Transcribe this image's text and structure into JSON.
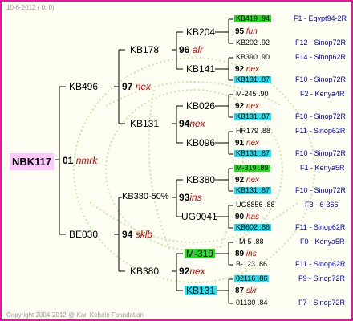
{
  "header": "10-6-2012 ( 0: 0)",
  "footer": "Copyright 2004-2012 @ Karl Kehele Foundation",
  "root": {
    "ring": "NBK117",
    "score": "01",
    "adj": "nmrk"
  },
  "gen1": [
    {
      "ring": "KB496",
      "score": "97",
      "adj": "nex"
    },
    {
      "ring": "BE030",
      "score": "94",
      "adj": "sklb"
    }
  ],
  "gen2": [
    {
      "ring": "KB178",
      "score": "96",
      "adj": "alr"
    },
    {
      "ring": "KB131",
      "score": "94",
      "adj": "nex"
    },
    {
      "ring": "KB380-50%",
      "score": "93",
      "adj": "ins"
    },
    {
      "ring": "KB380",
      "score": "92",
      "adj": "nex"
    }
  ],
  "gen3": [
    {
      "ring": "KB204",
      "score": "95",
      "adj": "fun"
    },
    {
      "ring": "KB141",
      "score": "92",
      "adj": "nex"
    },
    {
      "ring": "KB026",
      "score": "92",
      "adj": "nex"
    },
    {
      "ring": "KB096",
      "score": "91",
      "adj": "nex"
    },
    {
      "ring": "KB380",
      "score": "92",
      "adj": "nex"
    },
    {
      "ring": "UG9041",
      "score": "90",
      "adj": "has"
    },
    {
      "ring": "M-319",
      "score": "89",
      "adj": "ins"
    },
    {
      "ring": "KB131",
      "score": "87",
      "adj": "sl/r"
    }
  ],
  "gen4": [
    {
      "ring": "KB419",
      "val": ".94",
      "ref": "F1 - Egypt94-2R"
    },
    {
      "ring": "KB202",
      "val": ".92",
      "ref": "F12 - Sinop72R"
    },
    {
      "ring": "KB390",
      "val": ".90",
      "ref": "F14 - Sinop62R"
    },
    {
      "ring": "KB131",
      "val": ".87",
      "ref": "F10 - Sinop72R"
    },
    {
      "ring": "M-245",
      "val": ".90",
      "ref": "F2 - Kenya4R"
    },
    {
      "ring": "KB131",
      "val": ".87",
      "ref": "F10 - Sinop72R"
    },
    {
      "ring": "HR179",
      "val": ".88",
      "ref": "F11 - Sinop62R"
    },
    {
      "ring": "KB131",
      "val": ".87",
      "ref": "F10 - Sinop72R"
    },
    {
      "ring": "M-319",
      "val": ".89",
      "ref": "F1 - Kenya5R"
    },
    {
      "ring": "KB131",
      "val": ".87",
      "ref": "F10 - Sinop72R"
    },
    {
      "ring": "UG8856",
      "val": ".88",
      "ref": "F3 - 6-366"
    },
    {
      "ring": "KB602",
      "val": ".86",
      "ref": "F11 - Sinop62R"
    },
    {
      "ring": "M-5",
      "val": ".88",
      "ref": "F0 - Kenya5R"
    },
    {
      "ring": "B-123",
      "val": ".86",
      "ref": "F11 - Sinop62R"
    },
    {
      "ring": "02116",
      "val": ".86",
      "ref": "F9 - Sinop72R"
    },
    {
      "ring": "01130",
      "val": ".84",
      "ref": "F7 - Sinop72R"
    }
  ],
  "colors": {
    "border": "#e6189a",
    "background": "#fffff4",
    "green": "#22dd22",
    "cyan": "#22e0f0",
    "adjective": "#cc0000",
    "reference": "#0000cc"
  }
}
